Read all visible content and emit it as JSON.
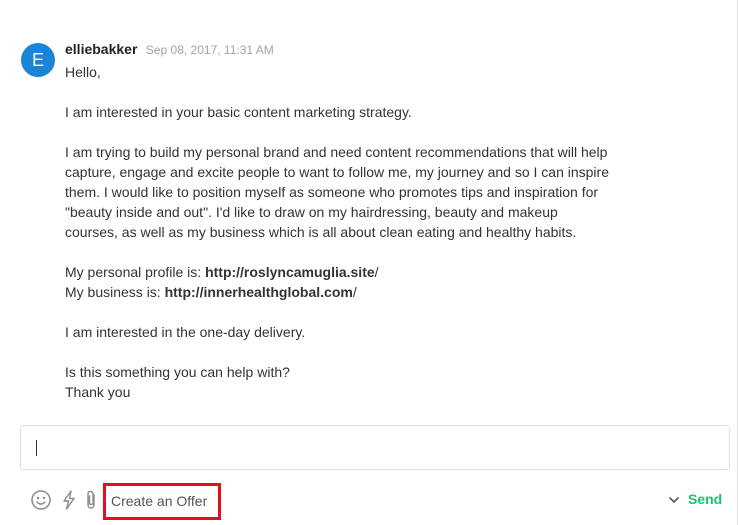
{
  "message": {
    "avatar_letter": "E",
    "username": "elliebakker",
    "timestamp": "Sep 08, 2017, 11:31 AM",
    "greeting": "Hello,",
    "paragraph_1": "I am interested in your basic content marketing strategy.",
    "paragraph_2": "I am trying to build my personal brand and need content recommendations that will help capture, engage and excite people to want to follow me, my journey and so I can inspire them. I would like to position myself as someone who promotes tips and inspiration for \"beauty inside and out\". I'd like to draw on my hairdressing, beauty and makeup courses, as well as my business which is all about clean eating and healthy habits.",
    "profile_label": "My personal profile is: ",
    "profile_link": "http://roslyncamuglia.site",
    "profile_suffix": "/",
    "business_label": "My business is: ",
    "business_link": "http://innerhealthglobal.com",
    "business_suffix": "/",
    "paragraph_4": "I am interested in the one-day delivery.",
    "question": "Is this something you can help with?",
    "closing": "Thank you"
  },
  "composer": {
    "value": ""
  },
  "toolbar": {
    "offer_label": "Create an Offer",
    "send_label": "Send"
  },
  "icons": {
    "emoji": "smiley-icon",
    "quick_response": "lightning-icon",
    "attach": "paperclip-icon",
    "send_options": "chevron-down-icon"
  },
  "colors": {
    "avatar": "#1b84d6",
    "send": "#1dbf73",
    "highlight": "#e0101e"
  }
}
